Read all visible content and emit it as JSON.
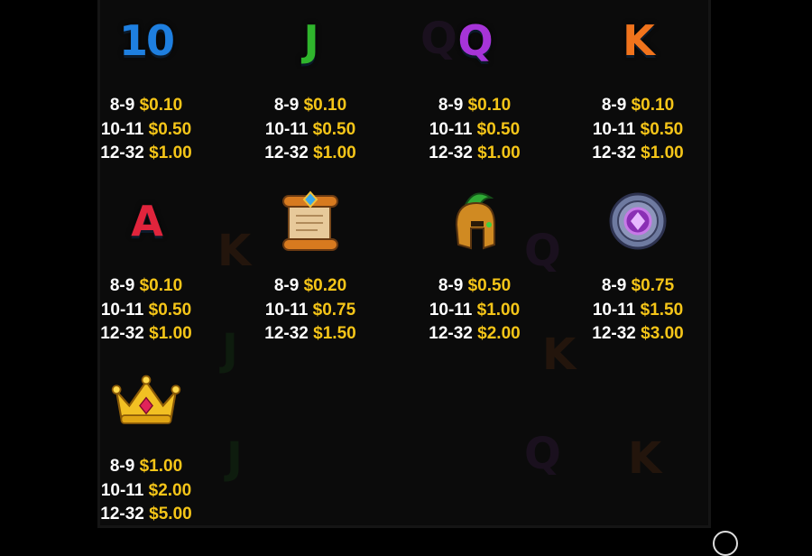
{
  "symbols": [
    {
      "id": "ten",
      "icon": "ten-symbol-icon",
      "letter": "10",
      "color": "#1e7fe0",
      "pays": [
        {
          "range": "8-9",
          "value": "$0.10"
        },
        {
          "range": "10-11",
          "value": "$0.50"
        },
        {
          "range": "12-32",
          "value": "$1.00"
        }
      ]
    },
    {
      "id": "jack",
      "icon": "jack-symbol-icon",
      "letter": "J",
      "color": "#2fb52c",
      "pays": [
        {
          "range": "8-9",
          "value": "$0.10"
        },
        {
          "range": "10-11",
          "value": "$0.50"
        },
        {
          "range": "12-32",
          "value": "$1.00"
        }
      ]
    },
    {
      "id": "queen",
      "icon": "queen-symbol-icon",
      "letter": "Q",
      "color": "#a634d8",
      "pays": [
        {
          "range": "8-9",
          "value": "$0.10"
        },
        {
          "range": "10-11",
          "value": "$0.50"
        },
        {
          "range": "12-32",
          "value": "$1.00"
        }
      ]
    },
    {
      "id": "king",
      "icon": "king-symbol-icon",
      "letter": "K",
      "color": "#f0731c",
      "pays": [
        {
          "range": "8-9",
          "value": "$0.10"
        },
        {
          "range": "10-11",
          "value": "$0.50"
        },
        {
          "range": "12-32",
          "value": "$1.00"
        }
      ]
    },
    {
      "id": "ace",
      "icon": "ace-symbol-icon",
      "letter": "A",
      "color": "#e0243c",
      "pays": [
        {
          "range": "8-9",
          "value": "$0.10"
        },
        {
          "range": "10-11",
          "value": "$0.50"
        },
        {
          "range": "12-32",
          "value": "$1.00"
        }
      ]
    },
    {
      "id": "scroll",
      "icon": "scroll-symbol-icon",
      "pays": [
        {
          "range": "8-9",
          "value": "$0.20"
        },
        {
          "range": "10-11",
          "value": "$0.75"
        },
        {
          "range": "12-32",
          "value": "$1.50"
        }
      ]
    },
    {
      "id": "helmet",
      "icon": "helmet-symbol-icon",
      "pays": [
        {
          "range": "8-9",
          "value": "$0.50"
        },
        {
          "range": "10-11",
          "value": "$1.00"
        },
        {
          "range": "12-32",
          "value": "$2.00"
        }
      ]
    },
    {
      "id": "shield",
      "icon": "shield-symbol-icon",
      "pays": [
        {
          "range": "8-9",
          "value": "$0.75"
        },
        {
          "range": "10-11",
          "value": "$1.50"
        },
        {
          "range": "12-32",
          "value": "$3.00"
        }
      ]
    },
    {
      "id": "crown",
      "icon": "crown-symbol-icon",
      "pays": [
        {
          "range": "8-9",
          "value": "$1.00"
        },
        {
          "range": "10-11",
          "value": "$2.00"
        },
        {
          "range": "12-32",
          "value": "$5.00"
        }
      ]
    }
  ],
  "colors": {
    "range_text": "#ffffff",
    "value_text": "#f5c518",
    "background": "#000000"
  }
}
